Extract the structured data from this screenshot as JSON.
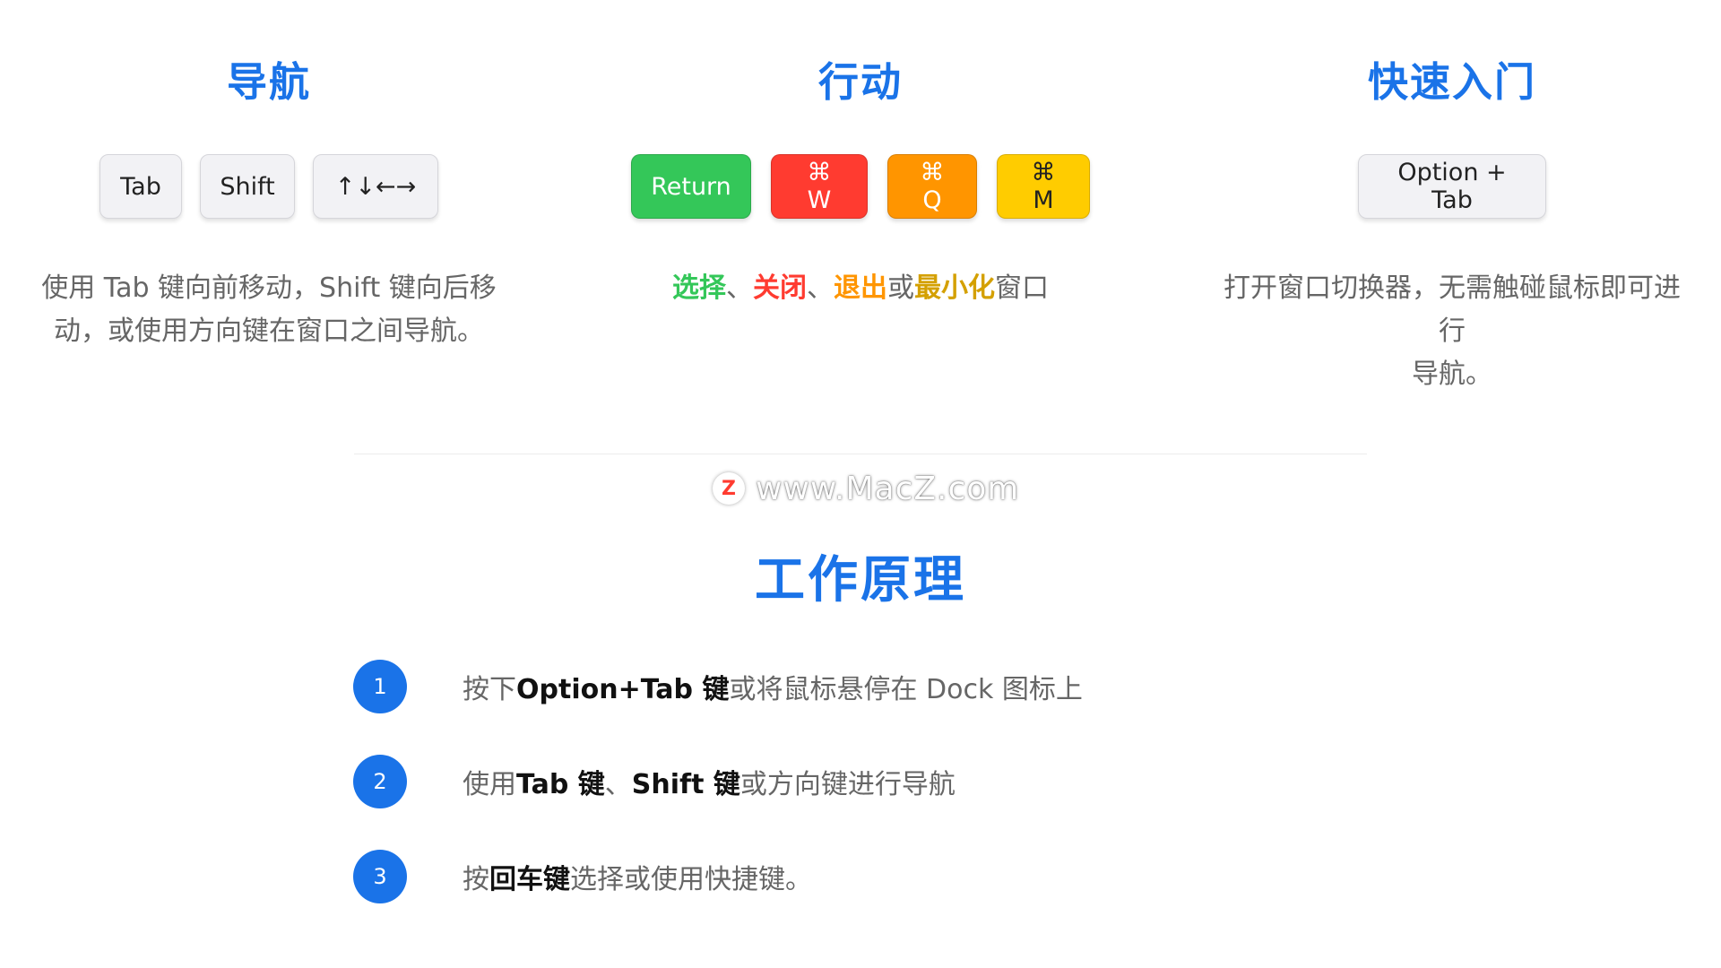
{
  "navigation": {
    "title": "导航",
    "keys": [
      "Tab",
      "Shift",
      "↑↓←→"
    ],
    "desc_line1": "使用 Tab 键向前移动，Shift 键向后移",
    "desc_line2": "动，或使用方向键在窗口之间导航。"
  },
  "actions": {
    "title": "行动",
    "keys": [
      "Return",
      "⌘ W",
      "⌘ Q",
      "⌘ M"
    ],
    "desc": {
      "select": "选择",
      "sep1": "、",
      "close": "关闭",
      "sep2": "、",
      "quit": "退出",
      "or": "或",
      "minimize": "最小化",
      "window": "窗口"
    }
  },
  "quick_start": {
    "title": "快速入门",
    "key": "Option + Tab",
    "desc_line1": "打开窗口切换器，无需触碰鼠标即可进行",
    "desc_line2": "导航。"
  },
  "watermark": {
    "logo": "Z",
    "text": "www.MacZ.com"
  },
  "how_it_works": {
    "title": "工作原理",
    "steps": [
      {
        "num": "1",
        "a": "按下",
        "b": "Option+Tab 键",
        "c": "或将鼠标悬停在 Dock 图标上"
      },
      {
        "num": "2",
        "a": "使用",
        "b": "Tab 键",
        "c": "、",
        "d": "Shift 键",
        "e": "或方向键进行导航"
      },
      {
        "num": "3",
        "a": "按",
        "b": "回车键",
        "c": "选择或使用快捷键。"
      }
    ]
  },
  "colors": {
    "accent": "#1a73e8",
    "green": "#34c759",
    "red": "#ff3b30",
    "orange": "#ff9500",
    "yellow": "#ffcc00"
  }
}
